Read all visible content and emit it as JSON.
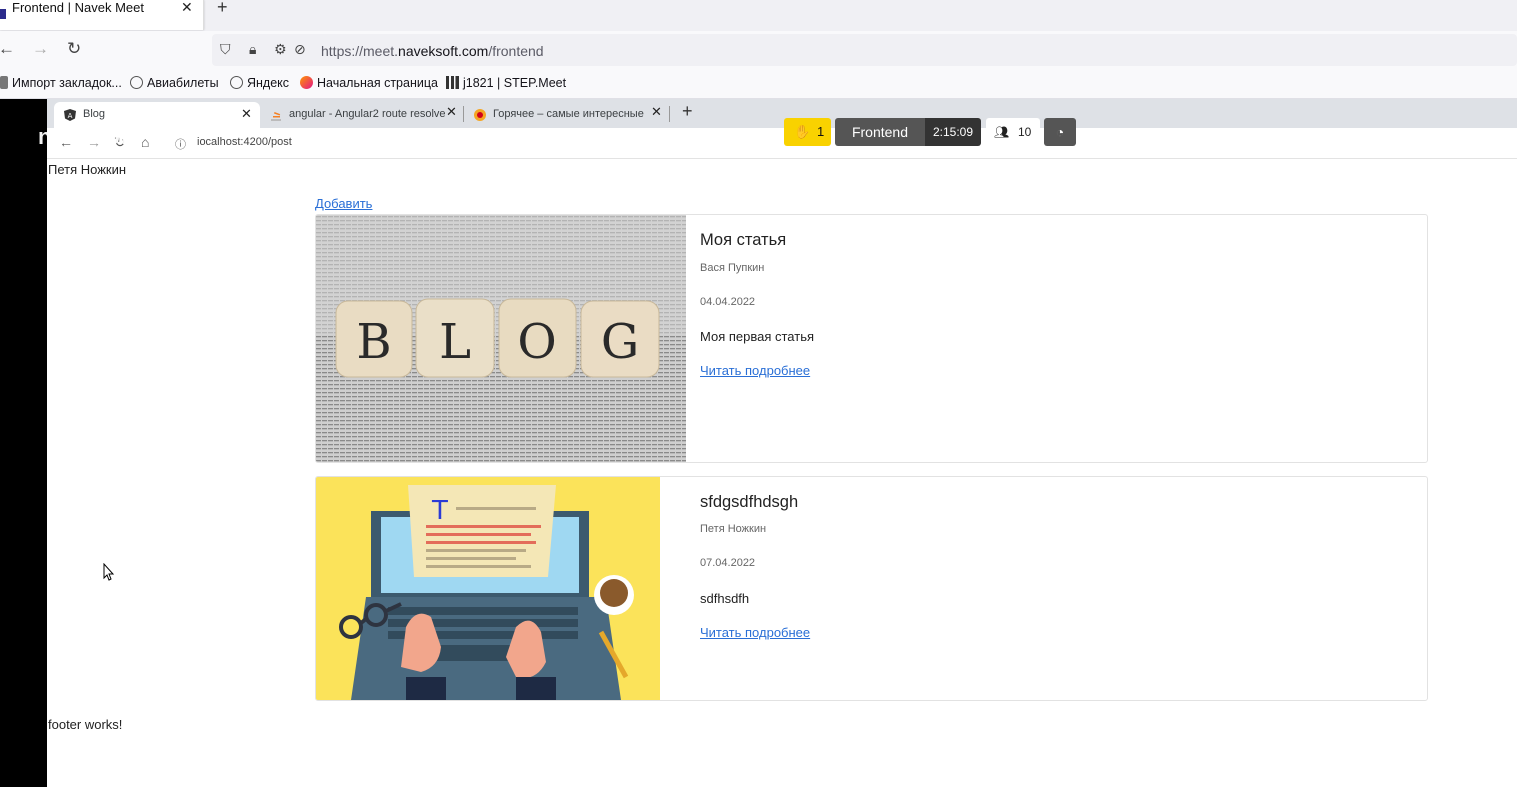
{
  "outer_browser": {
    "tab_title": "Frontend | Navek Meet",
    "url_prefix": "https://meet.",
    "url_domain": "naveksoft.com",
    "url_path": "/frontend",
    "bookmarks": [
      {
        "label": "Импорт закладок...",
        "icon": "bookmark-import-icon"
      },
      {
        "label": "Авиабилеты",
        "icon": "globe-icon"
      },
      {
        "label": "Яндекс",
        "icon": "globe-icon"
      },
      {
        "label": "Начальная страница",
        "icon": "firefox-icon"
      },
      {
        "label": "j1821 | STEP.Meet",
        "icon": "step-meet-icon"
      }
    ]
  },
  "shared_browser": {
    "tabs": [
      {
        "label": "Blog",
        "active": true
      },
      {
        "label": "angular - Angular2 route resolve"
      },
      {
        "label": "Горячее – самые интересные и"
      }
    ],
    "url": "iocalhost:4200/post",
    "overlay_text": "n      ek.soft"
  },
  "meet": {
    "hand_count": "1",
    "room_name": "Frontend",
    "timer": "2:15:09",
    "participants": "10"
  },
  "page": {
    "user_name": "Петя Ножкин",
    "add_label": "Добавить",
    "posts": [
      {
        "title": "Моя статья",
        "author": "Вася Пупкин",
        "date": "04.04.2022",
        "text": "Моя первая статья",
        "more": "Читать подробнее",
        "image_text": "BLOG"
      },
      {
        "title": "sfdgsdfhdsgh",
        "author": "Петя Ножкин",
        "date": "07.04.2022",
        "text": "sdfhsdfh",
        "more": "Читать подробнее",
        "image_text": "T"
      }
    ],
    "footer": "footer works!"
  },
  "colors": {
    "link": "#2a6fd6",
    "meet_hand": "#f9d200"
  }
}
